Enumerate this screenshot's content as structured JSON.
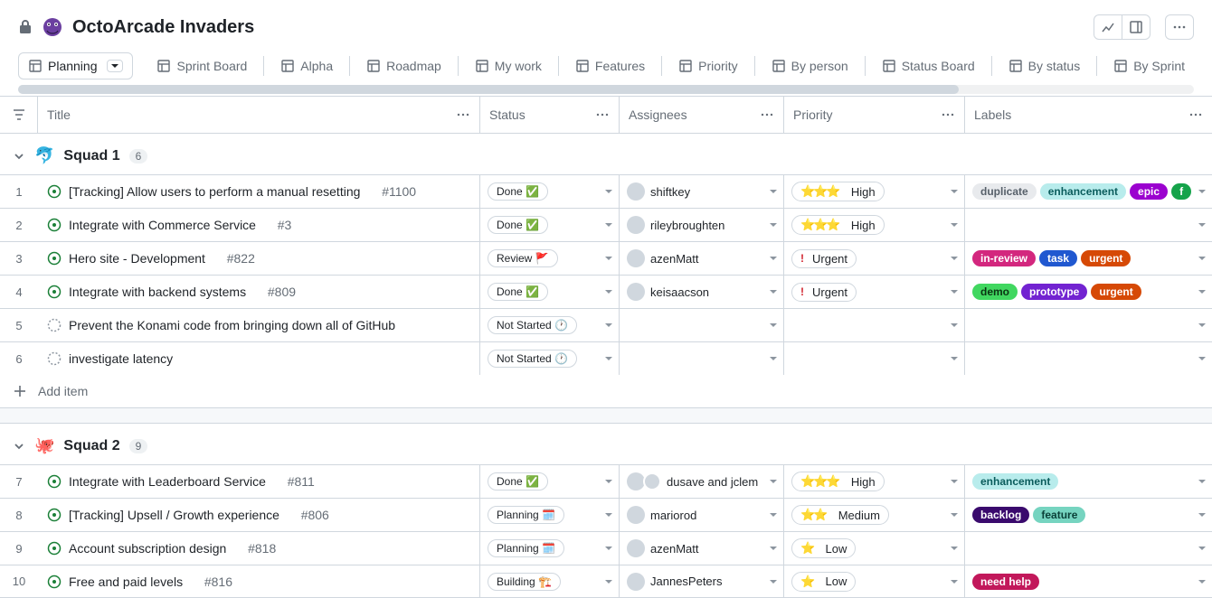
{
  "project": {
    "title": "OctoArcade Invaders"
  },
  "header_buttons": {
    "insights": "insights",
    "panel": "panel",
    "more": "more"
  },
  "tabs": [
    {
      "id": "planning",
      "label": "Planning",
      "active": true,
      "hasCaret": true
    },
    {
      "id": "sprint-board",
      "label": "Sprint Board"
    },
    {
      "id": "alpha",
      "label": "Alpha"
    },
    {
      "id": "roadmap",
      "label": "Roadmap"
    },
    {
      "id": "my-work",
      "label": "My work"
    },
    {
      "id": "features",
      "label": "Features"
    },
    {
      "id": "priority",
      "label": "Priority"
    },
    {
      "id": "by-person",
      "label": "By person"
    },
    {
      "id": "status-board",
      "label": "Status Board"
    },
    {
      "id": "by-status",
      "label": "By status"
    },
    {
      "id": "by-sprint",
      "label": "By Sprint"
    }
  ],
  "columns": {
    "title": "Title",
    "status": "Status",
    "assignees": "Assignees",
    "priority": "Priority",
    "labels": "Labels"
  },
  "statuses": {
    "done": "Done ✅",
    "review": "Review 🚩",
    "not_started": "Not Started 🕐",
    "planning": "Planning 🗓️",
    "building": "Building 🏗️"
  },
  "priorities": {
    "high": {
      "icon": "⭐⭐⭐",
      "label": "High"
    },
    "urgent": {
      "icon": "❗",
      "label": "Urgent"
    },
    "medium": {
      "icon": "⭐⭐",
      "label": "Medium"
    },
    "low": {
      "icon": "⭐",
      "label": "Low"
    }
  },
  "labels": {
    "duplicate": "duplicate",
    "enhancement": "enhancement",
    "epic": "epic",
    "f": "f",
    "in_review": "in-review",
    "task": "task",
    "urgent": "urgent",
    "demo": "demo",
    "prototype": "prototype",
    "backlog": "backlog",
    "feature": "feature",
    "need_help": "need help"
  },
  "add_item": "Add item",
  "groups": [
    {
      "emoji": "🐬",
      "name": "Squad 1",
      "count": "6",
      "rows": [
        {
          "n": "1",
          "state": "open",
          "title": "[Tracking] Allow users to perform a manual resetting",
          "num": "#1100",
          "status": "done",
          "assignee": "shiftkey",
          "priority": "high",
          "labels": [
            "duplicate",
            "enhancement",
            "epic",
            "f"
          ]
        },
        {
          "n": "2",
          "state": "open",
          "title": "Integrate with Commerce Service",
          "num": "#3",
          "status": "done",
          "assignee": "rileybroughten",
          "priority": "high",
          "labels": []
        },
        {
          "n": "3",
          "state": "open",
          "title": "Hero site - Development",
          "num": "#822",
          "status": "review",
          "assignee": "azenMatt",
          "priority": "urgent",
          "labels": [
            "in_review",
            "task",
            "urgent"
          ]
        },
        {
          "n": "4",
          "state": "open",
          "title": "Integrate with backend systems",
          "num": "#809",
          "status": "done",
          "assignee": "keisaacson",
          "priority": "urgent",
          "labels": [
            "demo",
            "prototype",
            "urgent"
          ]
        },
        {
          "n": "5",
          "state": "draft",
          "title": "Prevent the Konami code from bringing down all of GitHub",
          "num": "",
          "status": "not_started",
          "assignee": "",
          "priority": "",
          "labels": []
        },
        {
          "n": "6",
          "state": "draft",
          "title": "investigate latency",
          "num": "",
          "status": "not_started",
          "assignee": "",
          "priority": "",
          "labels": []
        }
      ]
    },
    {
      "emoji": "🐙",
      "name": "Squad 2",
      "count": "9",
      "rows": [
        {
          "n": "7",
          "state": "open",
          "title": "Integrate with Leaderboard Service",
          "num": "#811",
          "status": "done",
          "assignee": "dusave and jclem",
          "assignee_pair": true,
          "priority": "high",
          "labels": [
            "enhancement"
          ]
        },
        {
          "n": "8",
          "state": "open",
          "title": "[Tracking] Upsell / Growth experience",
          "num": "#806",
          "status": "planning",
          "assignee": "mariorod",
          "priority": "medium",
          "labels": [
            "backlog",
            "feature"
          ]
        },
        {
          "n": "9",
          "state": "open",
          "title": "Account subscription design",
          "num": "#818",
          "status": "planning",
          "assignee": "azenMatt",
          "priority": "low",
          "labels": []
        },
        {
          "n": "10",
          "state": "open",
          "title": "Free and paid levels",
          "num": "#816",
          "status": "building",
          "assignee": "JannesPeters",
          "priority": "low",
          "labels": [
            "need_help"
          ]
        }
      ]
    }
  ]
}
